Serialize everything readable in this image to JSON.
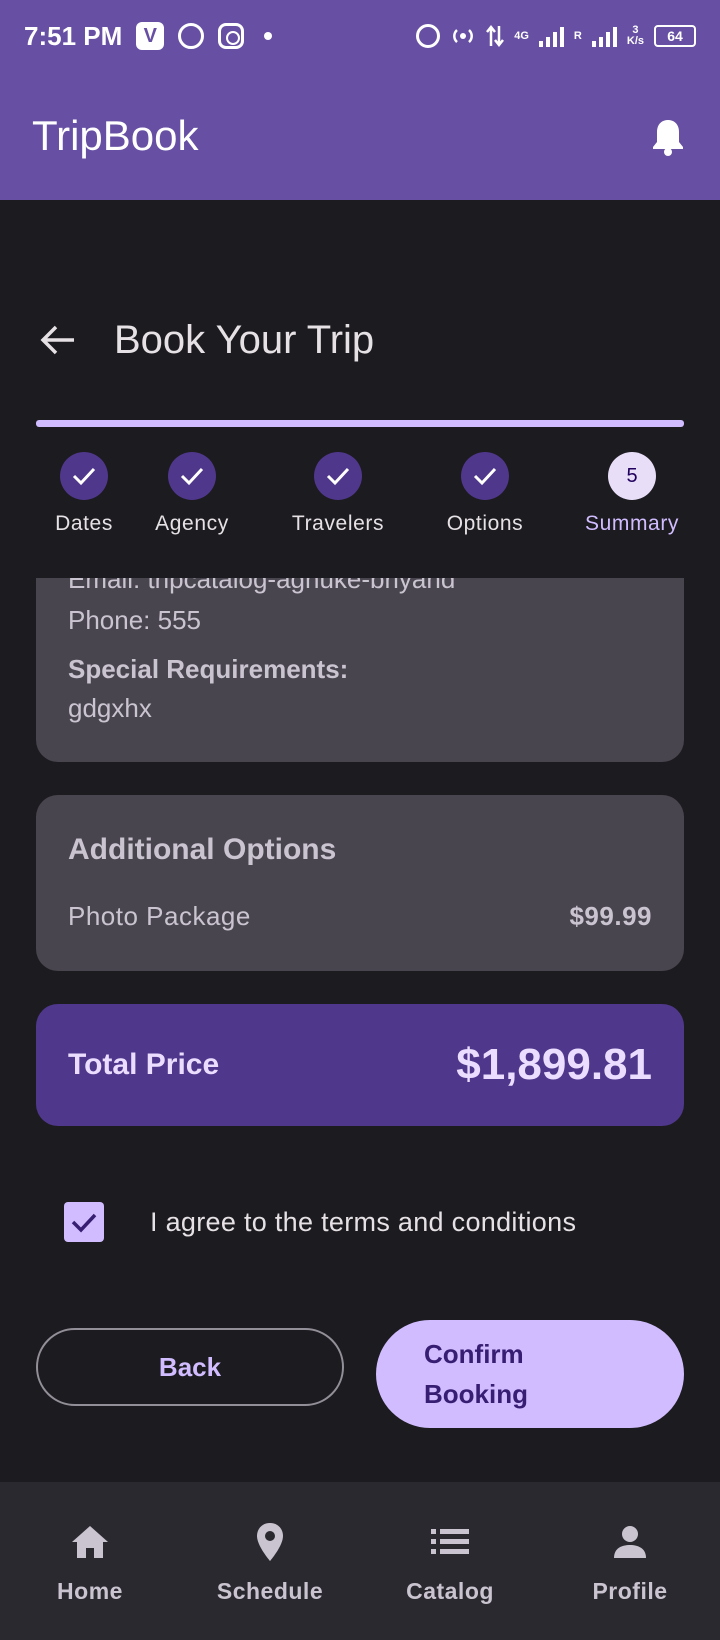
{
  "status_bar": {
    "time": "7:51 PM",
    "network": "4G",
    "roaming": "R",
    "speed_value": "3",
    "speed_unit": "K/s",
    "battery": "64"
  },
  "app_bar": {
    "title": "TripBook"
  },
  "page": {
    "title": "Book Your Trip"
  },
  "stepper": {
    "steps": [
      {
        "label": "Dates",
        "state": "done"
      },
      {
        "label": "Agency",
        "state": "done"
      },
      {
        "label": "Travelers",
        "state": "done"
      },
      {
        "label": "Options",
        "state": "done"
      },
      {
        "label": "Summary",
        "state": "active",
        "number": "5"
      }
    ]
  },
  "contact_card": {
    "email_line": "Email: tripcatalog-agnuke-briyand",
    "phone_line": "Phone: 555",
    "special_label": "Special Requirements:",
    "special_value": "gdgxhx"
  },
  "options_card": {
    "title": "Additional Options",
    "items": [
      {
        "name": "Photo Package",
        "price": "$99.99"
      }
    ]
  },
  "total": {
    "label": "Total Price",
    "value": "$1,899.81"
  },
  "terms": {
    "label": "I agree to the terms and conditions",
    "checked": true
  },
  "buttons": {
    "back": "Back",
    "confirm": "Confirm Booking"
  },
  "bottom_nav": {
    "items": [
      {
        "label": "Home",
        "icon": "home-icon"
      },
      {
        "label": "Schedule",
        "icon": "location-pin-icon"
      },
      {
        "label": "Catalog",
        "icon": "list-icon"
      },
      {
        "label": "Profile",
        "icon": "person-icon"
      }
    ]
  },
  "colors": {
    "primary": "#6750a4",
    "accent": "#d0bcff",
    "surface": "#49454f",
    "total_bg": "#4f378b"
  }
}
